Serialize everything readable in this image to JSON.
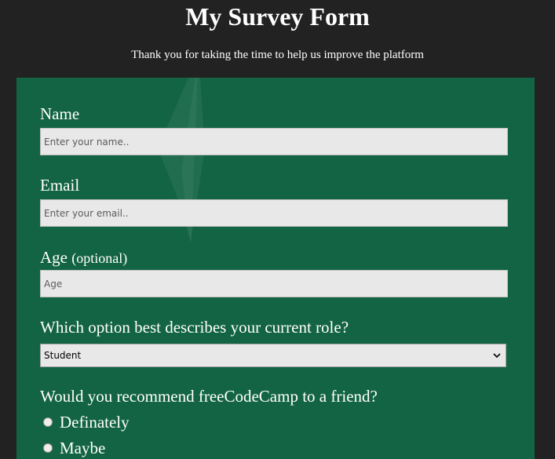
{
  "header": {
    "title": "My Survey Form",
    "description": "Thank you for taking the time to help us improve the platform"
  },
  "form": {
    "name": {
      "label": "Name",
      "placeholder": "Enter your name.."
    },
    "email": {
      "label": "Email",
      "placeholder": "Enter your email.."
    },
    "age": {
      "label": "Age",
      "optional": "(optional)",
      "placeholder": "Age"
    },
    "role": {
      "label": "Which option best describes your current role?",
      "selected": "Student"
    },
    "recommend": {
      "label": "Would you recommend freeCodeCamp to a friend?",
      "options": [
        "Definately",
        "Maybe"
      ]
    }
  },
  "icons": {
    "select_arrow": "chevron-down-icon",
    "radio": "radio-button"
  },
  "colors": {
    "page_background": "#222222",
    "form_background": "#136444",
    "input_background": "#e8e8e8",
    "text": "#ffffff"
  }
}
